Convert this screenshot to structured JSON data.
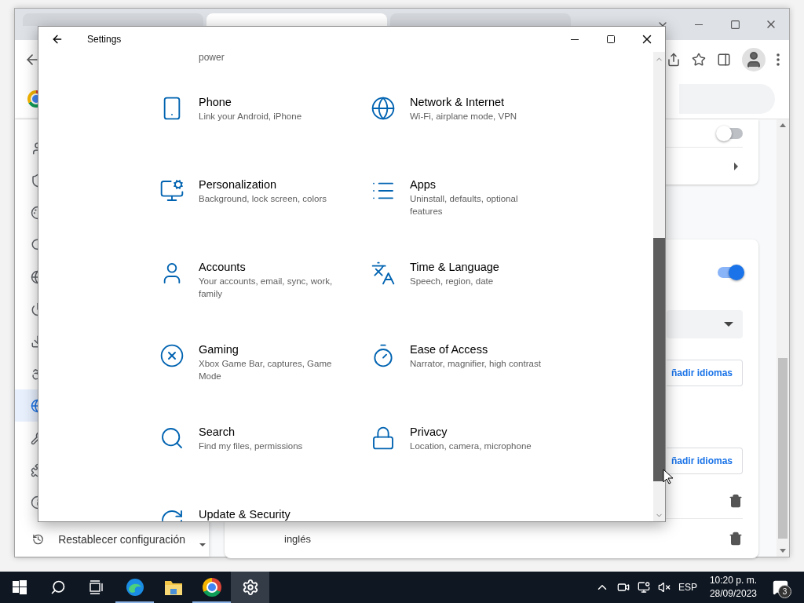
{
  "browser": {
    "tabs": [
      {
        "selected": false
      },
      {
        "selected": true
      },
      {
        "selected": false
      }
    ],
    "sidebar_items": [
      {
        "selected": false
      },
      {
        "selected": false
      },
      {
        "selected": false
      },
      {
        "selected": false
      },
      {
        "selected": false
      },
      {
        "selected": false
      },
      {
        "selected": false
      },
      {
        "selected": false
      },
      {
        "selected": true
      },
      {
        "selected": false
      },
      {
        "selected": false
      },
      {
        "selected": false
      }
    ],
    "sidebar_footer": "Restablecer configuración",
    "toggles": [
      {
        "on": false
      },
      {
        "on": true
      }
    ],
    "add_buttons": [
      "ñadir idiomas",
      "ñadir idiomas"
    ],
    "language_row_label": "inglés"
  },
  "settings": {
    "title": "Settings",
    "cut_off_text": "power",
    "items": [
      {
        "title": "Phone",
        "description": "Link your Android, iPhone"
      },
      {
        "title": "Network & Internet",
        "description": "Wi-Fi, airplane mode, VPN"
      },
      {
        "title": "Personalization",
        "description": "Background, lock screen, colors"
      },
      {
        "title": "Apps",
        "description": "Uninstall, defaults, optional features"
      },
      {
        "title": "Accounts",
        "description": "Your accounts, email, sync, work, family"
      },
      {
        "title": "Time & Language",
        "description": "Speech, region, date"
      },
      {
        "title": "Gaming",
        "description": "Xbox Game Bar, captures, Game Mode"
      },
      {
        "title": "Ease of Access",
        "description": "Narrator, magnifier, high contrast"
      },
      {
        "title": "Search",
        "description": "Find my files, permissions"
      },
      {
        "title": "Privacy",
        "description": "Location, camera, microphone"
      },
      {
        "title": "Update & Security"
      }
    ]
  },
  "taskbar": {
    "apps": [
      {
        "running": true,
        "selected": false
      },
      {
        "running": false,
        "selected": false
      },
      {
        "running": true,
        "selected": false
      },
      {
        "running": false,
        "selected": true
      }
    ],
    "language": "ESP",
    "time": "10:20 p. m.",
    "date": "28/09/2023",
    "notification_count": "3"
  }
}
